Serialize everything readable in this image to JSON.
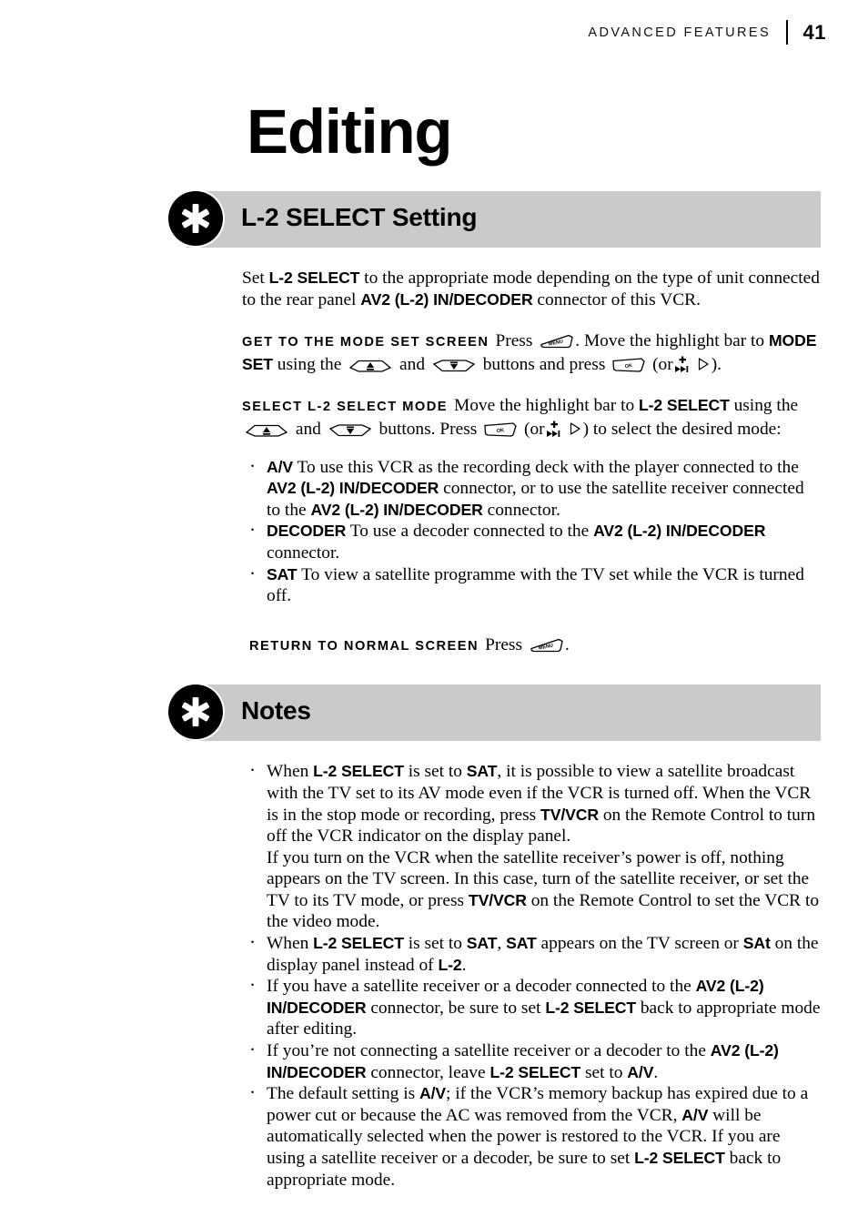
{
  "header": {
    "label": "ADVANCED FEATURES",
    "page_number": "41"
  },
  "chapter_title": "Editing",
  "sections": [
    {
      "id": "l2-select-setting",
      "title": "L-2 SELECT Setting",
      "icon": "asterisk-star-icon"
    },
    {
      "id": "notes",
      "title": "Notes",
      "icon": "asterisk-star-icon"
    }
  ],
  "intro": {
    "p1_a": "Set ",
    "p1_b": "L-2 SELECT",
    "p1_c": " to the appropriate mode depending on the type of unit connected to the rear panel ",
    "p1_d": "AV2 (L-2) IN/DECODER",
    "p1_e": " connector of this VCR."
  },
  "step_get_to_mode": {
    "label": "GET TO THE MODE SET SCREEN",
    "t1": "Press ",
    "t2": ". Move the highlight bar to ",
    "t3": "MODE SET",
    "t4": " using the ",
    "t5": " and ",
    "t6": " buttons and press ",
    "t7": " (or",
    "t8": ")."
  },
  "step_select_mode": {
    "label": "SELECT L-2 SELECT MODE",
    "t1": "Move the highlight bar to ",
    "t2": "L-2 SELECT",
    "t3": " using the ",
    "t4": " and ",
    "t5": " buttons. Press ",
    "t6": " (or",
    "t7": ") to select the desired mode:"
  },
  "modes": [
    {
      "name": "A/V",
      "text_a": " To use this VCR as the recording deck with the player connected to the ",
      "bold_b": "AV2 (L-2) IN/DECODER",
      "text_c": " connector, or to use the satellite receiver connected to the ",
      "bold_d": "AV2 (L-2) IN/DECODER",
      "text_e": " connector."
    },
    {
      "name": "DECODER",
      "text_a": " To use a decoder connected to the ",
      "bold_b": "AV2 (L-2) IN/DECODER",
      "text_c": " connector."
    },
    {
      "name": "SAT",
      "text_a": " To view a satellite programme with the TV set while the VCR is turned off."
    }
  ],
  "step_return": {
    "label": "RETURN TO NORMAL SCREEN",
    "t1": "Press ",
    "t2": "."
  },
  "notes": {
    "n1": {
      "a": "When ",
      "b": "L-2 SELECT",
      "c": " is set to ",
      "d": "SAT",
      "e": ", it is possible to view a satellite broadcast with the TV set to its AV mode even if the VCR is turned off. When the VCR is in the stop mode or recording, press ",
      "f": "TV/VCR",
      "g": " on the Remote Control to turn off the VCR indicator on the display panel.",
      "h": "If you turn on the VCR when the satellite receiver’s power is off, nothing appears on the TV screen. In this case, turn of the satellite receiver, or set the TV to its TV mode, or press ",
      "i": "TV/VCR",
      "j": " on the Remote Control to set the VCR to the video mode."
    },
    "n2": {
      "a": "When ",
      "b": "L-2 SELECT",
      "c": " is set to ",
      "d": "SAT",
      "e": ", ",
      "f": "SAT",
      "g": " appears on the TV screen or ",
      "h": "SAt",
      "i": " on the display panel instead of ",
      "j": "L-2",
      "k": "."
    },
    "n3": {
      "a": "If you have a satellite receiver or a decoder connected to the ",
      "b": "AV2 (L-2) IN/DECODER",
      "c": " connector, be sure to set ",
      "d": "L-2 SELECT",
      "e": " back to appropriate mode after editing."
    },
    "n4": {
      "a": "If you’re not connecting a satellite receiver or a decoder to the ",
      "b": "AV2 (L-2) IN/DECODER",
      "c": " connector, leave ",
      "d": "L-2 SELECT",
      "e": " set to ",
      "f": "A/V",
      "g": "."
    },
    "n5": {
      "a": "The default setting is ",
      "b": "A/V",
      "c": "; if the VCR’s memory backup has expired due to a power cut or because the AC was removed from the VCR, ",
      "d": "A/V",
      "e": " will be automatically selected when the power is restored to the VCR. If you are using a satellite receiver or a decoder, be sure to set ",
      "f": "L-2 SELECT",
      "g": " back to appropriate mode."
    }
  },
  "keys": {
    "menu": "MENU",
    "ok": "OK",
    "up": "up-arrow-button",
    "down": "down-arrow-button",
    "skip": "skip-forward-button",
    "play": "play-button"
  },
  "colors": {
    "banner_gray": "#cacaca",
    "ink": "#000000",
    "page": "#ffffff"
  }
}
